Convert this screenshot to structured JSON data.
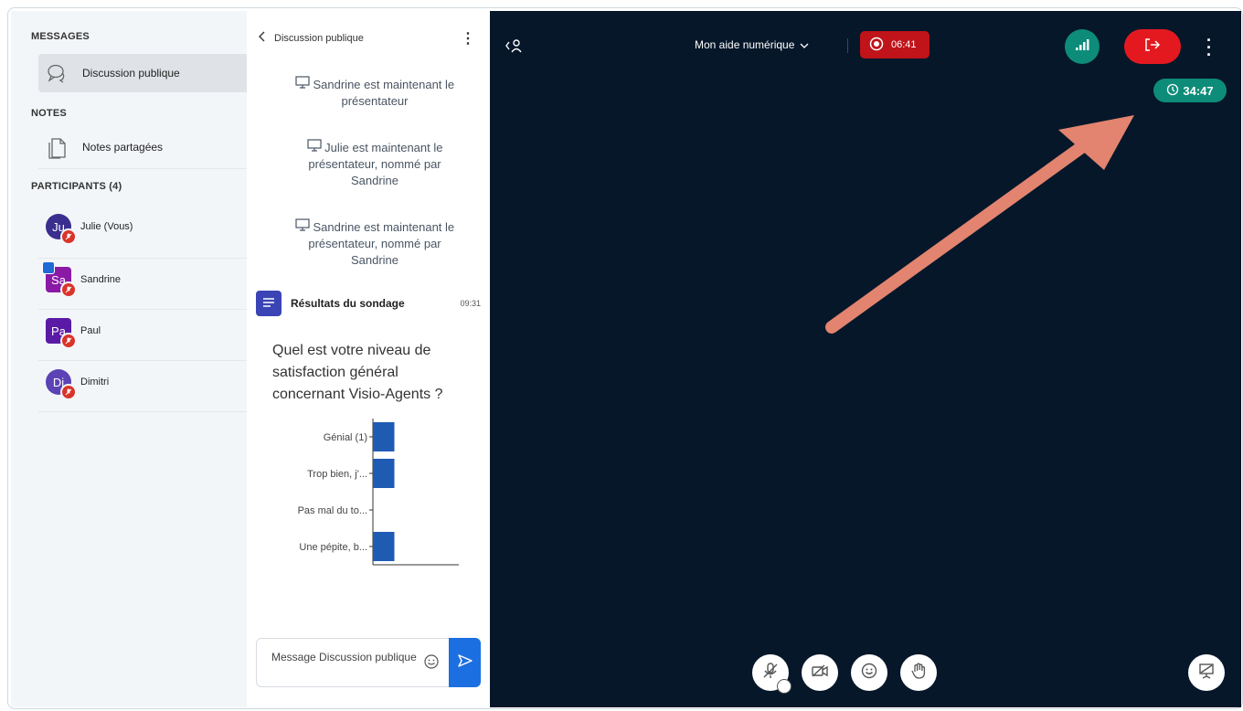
{
  "sidebar": {
    "messages_title": "MESSAGES",
    "public_chat": "Discussion publique",
    "notes_title": "NOTES",
    "shared_notes": "Notes partagées",
    "participants_title": "PARTICIPANTS (4)",
    "participants": [
      {
        "initials": "Ju",
        "name": "Julie (Vous)",
        "color": "#3a2f8f"
      },
      {
        "initials": "Sa",
        "name": "Sandrine",
        "color": "#8a1aa6"
      },
      {
        "initials": "Pa",
        "name": "Paul",
        "color": "#5a1aa6"
      },
      {
        "initials": "Di",
        "name": "Dimitri",
        "color": "#5b43b5"
      }
    ]
  },
  "chat": {
    "header": "Discussion publique",
    "system_messages": [
      "Sandrine est maintenant le présentateur",
      "Julie est maintenant le présentateur, nommé par Sandrine",
      "Sandrine est maintenant le présentateur, nommé par Sandrine"
    ],
    "poll": {
      "title": "Résultats du sondage",
      "time": "09:31",
      "question": "Quel est votre niveau de satisfaction général concernant Visio-Agents ?"
    },
    "input_placeholder": "Message Discussion publique"
  },
  "chart_data": {
    "type": "bar",
    "orientation": "horizontal",
    "categories": [
      "Génial (1)",
      "Trop bien, j'...",
      "Pas mal du to...",
      "Une pépite, b..."
    ],
    "values": [
      1,
      1,
      0,
      1
    ],
    "xlim": [
      0,
      4
    ],
    "xticks": [
      "0",
      "1",
      "2",
      "3",
      "4"
    ],
    "color": "#1f5bb3"
  },
  "main": {
    "meeting_title": "Mon aide numérique",
    "recording_time": "06:41",
    "session_timer": "34:47",
    "accent_green": "#0d8c7a",
    "leave_color": "#e4191f"
  }
}
